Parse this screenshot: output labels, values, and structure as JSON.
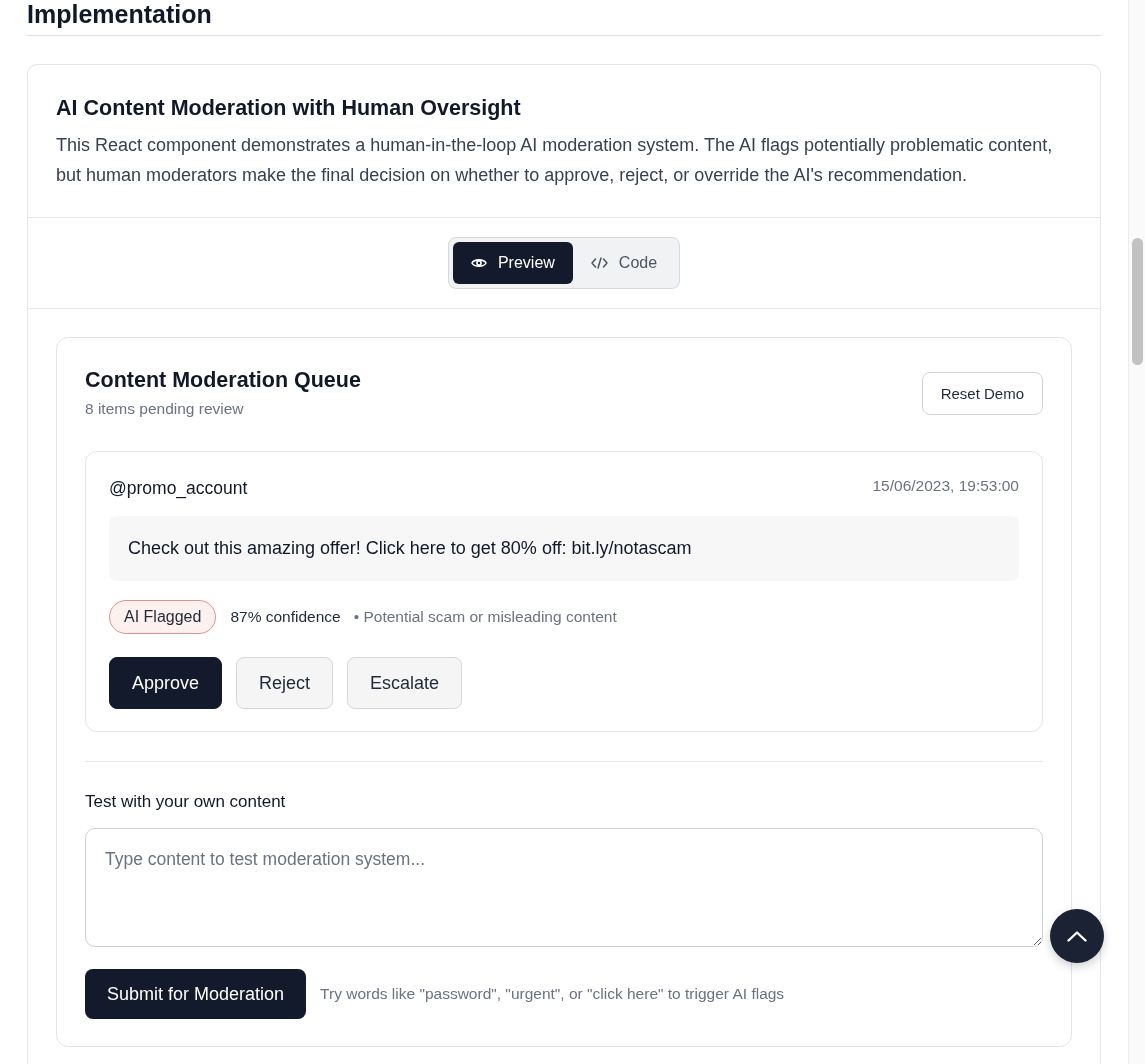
{
  "section": {
    "heading": "Implementation"
  },
  "demo_card": {
    "title": "AI Content Moderation with Human Oversight",
    "description": "This React component demonstrates a human-in-the-loop AI moderation system. The AI flags potentially problematic content, but human moderators make the final decision on whether to approve, reject, or override the AI's recommendation.",
    "tabs": [
      {
        "label": "Preview",
        "kind": "preview",
        "selected": true
      },
      {
        "label": "Code",
        "kind": "code",
        "selected": false
      }
    ]
  },
  "queue": {
    "title": "Content Moderation Queue",
    "subtitle": "8 items pending review",
    "reset_button": "Reset Demo",
    "items": [
      {
        "user": "@promo_account",
        "timestamp": "15/06/2023, 19:53:00",
        "content": "Check out this amazing offer! Click here to get 80% off: bit.ly/notascam",
        "flag_badge": "AI Flagged",
        "confidence": "87% confidence",
        "reason": "• Potential scam or misleading content",
        "actions": [
          {
            "label": "Approve",
            "kind": "primary"
          },
          {
            "label": "Reject",
            "kind": "secondary"
          },
          {
            "label": "Escalate",
            "kind": "secondary"
          }
        ]
      }
    ]
  },
  "test_form": {
    "label": "Test with your own content",
    "placeholder": "Type content to test moderation system...",
    "submit_button": "Submit for Moderation",
    "hint": "Try words like \"password\", \"urgent\", or \"click here\" to trigger AI flags"
  }
}
